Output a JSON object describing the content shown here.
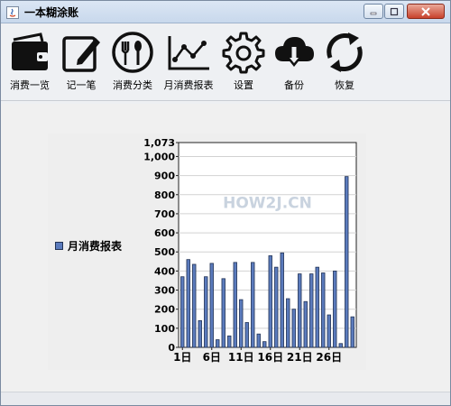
{
  "window": {
    "title": "一本糊涂账"
  },
  "toolbar": {
    "items": [
      {
        "label": "消费一览",
        "icon": "wallet-icon"
      },
      {
        "label": "记一笔",
        "icon": "edit-icon"
      },
      {
        "label": "消费分类",
        "icon": "utensils-icon"
      },
      {
        "label": "月消费报表",
        "icon": "line-chart-icon"
      },
      {
        "label": "设置",
        "icon": "gear-icon"
      },
      {
        "label": "备份",
        "icon": "cloud-download-icon"
      },
      {
        "label": "恢复",
        "icon": "refresh-icon"
      }
    ]
  },
  "watermark": "HOW2J.CN",
  "chart_data": {
    "type": "bar",
    "title": "",
    "xlabel": "",
    "ylabel": "",
    "legend": {
      "entries": [
        "月消费报表"
      ],
      "placement": "left"
    },
    "ylim": [
      0,
      1073
    ],
    "y_ticks": [
      "0",
      "100",
      "200",
      "300",
      "400",
      "500",
      "600",
      "700",
      "800",
      "900",
      "1,000",
      "1,073"
    ],
    "x_tick_labels": [
      "1日",
      "6日",
      "11日",
      "16日",
      "21日",
      "26日"
    ],
    "categories": [
      "1日",
      "2日",
      "3日",
      "4日",
      "5日",
      "6日",
      "7日",
      "8日",
      "9日",
      "10日",
      "11日",
      "12日",
      "13日",
      "14日",
      "15日",
      "16日",
      "17日",
      "18日",
      "19日",
      "20日",
      "21日",
      "22日",
      "23日",
      "24日",
      "25日",
      "26日",
      "27日",
      "28日",
      "29日",
      "30日"
    ],
    "series": [
      {
        "name": "月消费报表",
        "values": [
          370,
          460,
          435,
          140,
          370,
          440,
          40,
          360,
          60,
          445,
          250,
          130,
          445,
          70,
          30,
          480,
          420,
          495,
          255,
          200,
          385,
          240,
          385,
          420,
          390,
          170,
          400,
          20,
          895,
          160
        ]
      }
    ],
    "grid": true,
    "colors": {
      "bar": "#5b7bbd",
      "bar_edge": "#223355"
    }
  }
}
